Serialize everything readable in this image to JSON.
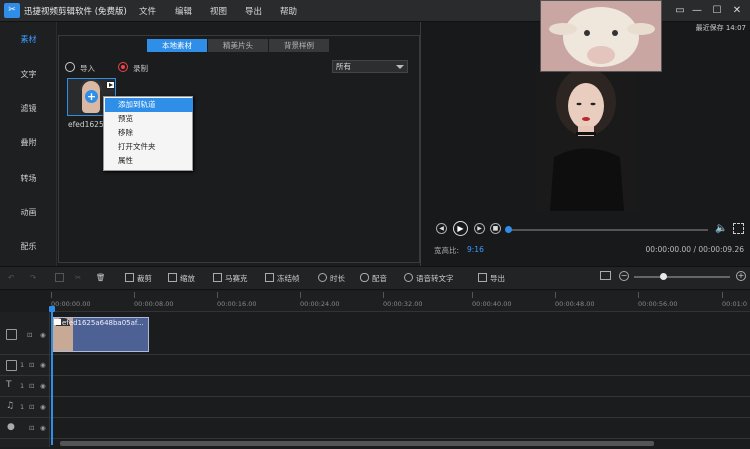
{
  "app": {
    "title": "迅捷视频剪辑软件 (免费版)",
    "logo_icon": "scissors-logo-icon"
  },
  "menu": [
    "文件",
    "编辑",
    "视图",
    "导出",
    "帮助"
  ],
  "window_controls": [
    "settings-icon",
    "minimize-icon",
    "maximize-icon",
    "close-icon"
  ],
  "sidebar": {
    "items": [
      {
        "label": "素材",
        "active": true
      },
      {
        "label": "文字",
        "active": false
      },
      {
        "label": "滤镜",
        "active": false
      },
      {
        "label": "叠附",
        "active": false
      },
      {
        "label": "转场",
        "active": false
      },
      {
        "label": "动画",
        "active": false
      },
      {
        "label": "配乐",
        "active": false
      }
    ]
  },
  "media": {
    "tabs": [
      {
        "label": "本地素材",
        "active": true
      },
      {
        "label": "精美片头",
        "active": false
      },
      {
        "label": "背景样例",
        "active": false
      }
    ],
    "import_label": "导入",
    "record_label": "录制",
    "filter_value": "所有",
    "thumbnail_name": "efed1625"
  },
  "context_menu": [
    {
      "label": "添加到轨道",
      "highlighted": true
    },
    {
      "label": "预览",
      "highlighted": false
    },
    {
      "label": "移除",
      "highlighted": false
    },
    {
      "label": "打开文件夹",
      "highlighted": false
    },
    {
      "label": "属性",
      "highlighted": false
    }
  ],
  "preview": {
    "autosave": "最近保存 14:07",
    "ratio_label": "宽高比:",
    "ratio_value": "9:16",
    "time": "00:00:00.00 / 00:00:09.26",
    "progress": 0.0
  },
  "toolbar": {
    "items": [
      {
        "label": "裁剪",
        "icon": "crop-icon"
      },
      {
        "label": "缩放",
        "icon": "zoom-icon"
      },
      {
        "label": "马赛克",
        "icon": "mosaic-icon"
      },
      {
        "label": "冻结帧",
        "icon": "freeze-frame-icon"
      },
      {
        "label": "时长",
        "icon": "duration-icon"
      },
      {
        "label": "配音",
        "icon": "microphone-icon"
      },
      {
        "label": "语音转文字",
        "icon": "speech-to-text-icon"
      },
      {
        "label": "导出",
        "icon": "export-icon"
      }
    ],
    "zoom_level": 0.3
  },
  "timeline": {
    "ticks": [
      "00:00:00.00",
      "00:00:08.00",
      "00:00:16.00",
      "00:00:24.00",
      "00:00:32.00",
      "00:00:40.00",
      "00:00:48.00",
      "00:00:56.00",
      "00:01:0"
    ],
    "track_count": "1",
    "clip_title": "efed1625a648ba05af..."
  },
  "colors": {
    "accent": "#2f8ee8",
    "clip": "#4d6194",
    "background": "#1b1c1e"
  }
}
